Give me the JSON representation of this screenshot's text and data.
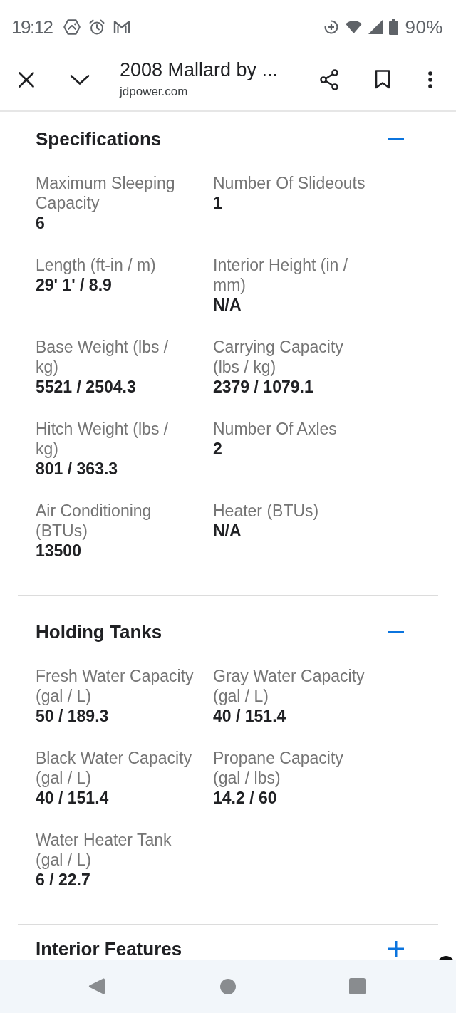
{
  "status_bar": {
    "time": "19:12",
    "battery": "90%"
  },
  "toolbar": {
    "title": "2008 Mallard by ...",
    "url": "jdpower.com"
  },
  "sections": [
    {
      "title": "Specifications",
      "expanded": true,
      "specs": [
        {
          "label": "Maximum Sleeping Capacity",
          "value": "6"
        },
        {
          "label": "Number Of Slideouts",
          "value": "1"
        },
        {
          "label": "Length (ft-in / m)",
          "value": "29' 1' / 8.9"
        },
        {
          "label": "Interior Height (in / mm)",
          "value": "N/A"
        },
        {
          "label": "Base Weight (lbs / kg)",
          "value": "5521 / 2504.3"
        },
        {
          "label": "Carrying Capacity (lbs / kg)",
          "value": "2379 / 1079.1"
        },
        {
          "label": "Hitch Weight (lbs / kg)",
          "value": "801 / 363.3"
        },
        {
          "label": "Number Of Axles",
          "value": "2"
        },
        {
          "label": "Air Conditioning (BTUs)",
          "value": "13500"
        },
        {
          "label": "Heater (BTUs)",
          "value": "N/A"
        }
      ]
    },
    {
      "title": "Holding Tanks",
      "expanded": true,
      "specs": [
        {
          "label": "Fresh Water Capacity (gal / L)",
          "value": "50 / 189.3"
        },
        {
          "label": "Gray Water Capacity (gal / L)",
          "value": "40 / 151.4"
        },
        {
          "label": "Black Water Capacity (gal / L)",
          "value": "40 / 151.4"
        },
        {
          "label": "Propane Capacity (gal / lbs)",
          "value": "14.2 / 60"
        },
        {
          "label": "Water Heater Tank (gal / L)",
          "value": "6 / 22.7"
        }
      ]
    },
    {
      "title": "Interior Features",
      "expanded": false
    }
  ]
}
